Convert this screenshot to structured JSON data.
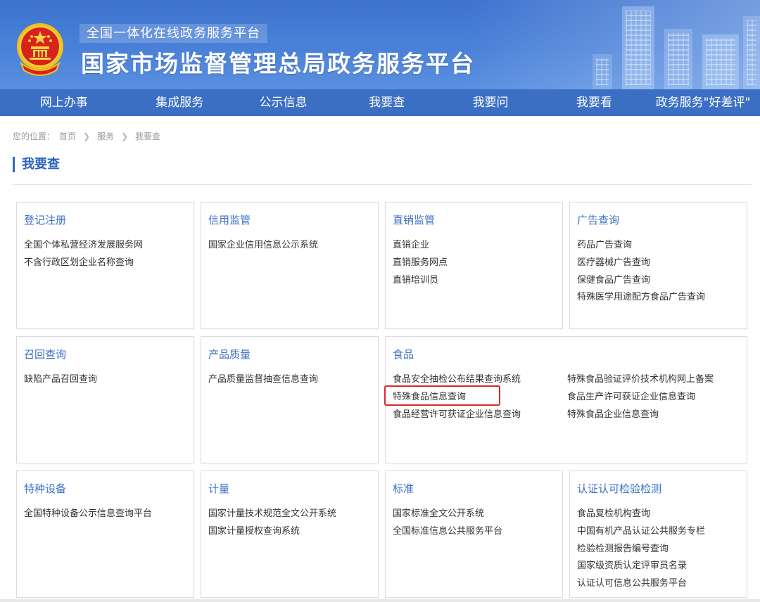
{
  "header": {
    "subtitle": "全国一体化在线政务服务平台",
    "title": "国家市场监督管理总局政务服务平台",
    "brand_color": "#3d73cf"
  },
  "nav": {
    "items": [
      "网上办事",
      "集成服务",
      "公示信息",
      "我要查",
      "我要问",
      "我要看",
      "政务服务\"好差评\""
    ]
  },
  "breadcrumb": {
    "prefix": "您的位置：",
    "items": [
      "首页",
      "服务",
      "我要查"
    ]
  },
  "section": {
    "title": "我要查"
  },
  "cards": [
    {
      "title": "登记注册",
      "links": [
        "全国个体私营经济发展服务网",
        "不含行政区划企业名称查询"
      ]
    },
    {
      "title": "信用监管",
      "links": [
        "国家企业信用信息公示系统"
      ]
    },
    {
      "title": "直销监管",
      "links": [
        "直销企业",
        "直销服务网点",
        "直销培训员"
      ]
    },
    {
      "title": "广告查询",
      "links": [
        "药品广告查询",
        "医疗器械广告查询",
        "保健食品广告查询",
        "特殊医学用途配方食品广告查询"
      ]
    },
    {
      "title": "召回查询",
      "links": [
        "缺陷产品召回查询"
      ]
    },
    {
      "title": "产品质量",
      "links": [
        "产品质量监督抽查信息查询"
      ]
    },
    {
      "title": "食品",
      "links": [
        "食品安全抽检公布结果查询系统",
        "特殊食品信息查询",
        "食品经营许可获证企业信息查询"
      ],
      "links_col2": [
        "特殊食品验证评价技术机构网上备案",
        "食品生产许可获证企业信息查询",
        "特殊食品企业信息查询"
      ]
    },
    {
      "title": "特种设备",
      "links": [
        "全国特种设备公示信息查询平台"
      ]
    },
    {
      "title": "计量",
      "links": [
        "国家计量技术规范全文公开系统",
        "国家计量授权查询系统"
      ]
    },
    {
      "title": "标准",
      "links": [
        "国家标准全文公开系统",
        "全国标准信息公共服务平台"
      ]
    },
    {
      "title": "认证认可检验检测",
      "links": [
        "食品复检机构查询",
        "中国有机产品认证公共服务专栏",
        "检验检测报告编号查询",
        "国家级资质认定评审员名录",
        "认证认可信息公共服务平台"
      ]
    }
  ],
  "highlight_color": "#e0262a"
}
